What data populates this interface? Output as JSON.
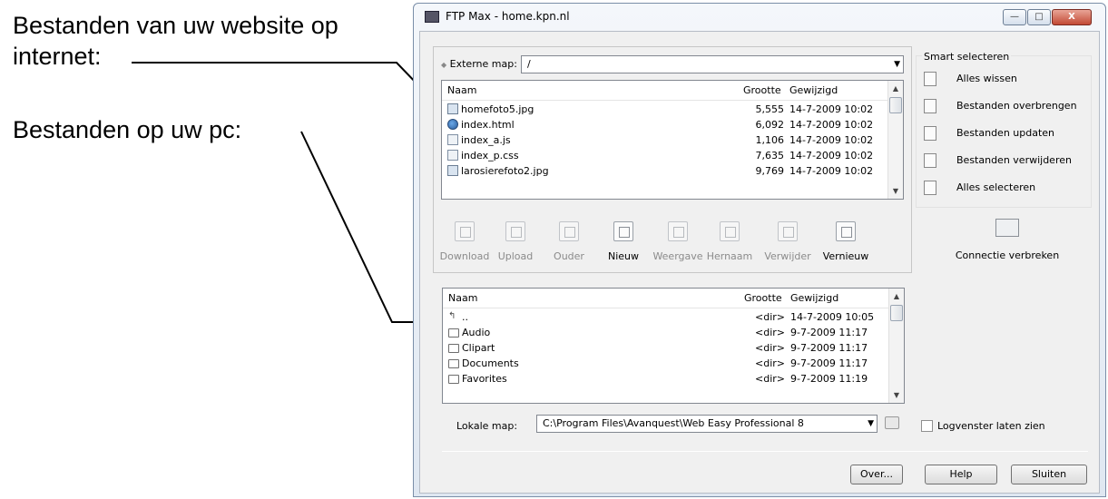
{
  "annotations": {
    "website_files": "Bestanden van uw website op internet:",
    "pc_files": "Bestanden op uw pc:"
  },
  "window": {
    "title": "FTP Max - home.kpn.nl",
    "controls": {
      "minimize": "—",
      "maximize": "□",
      "close": "X"
    }
  },
  "remote": {
    "map_label": "Externe map:",
    "map_value": "/",
    "columns": {
      "name": "Naam",
      "size": "Grootte",
      "modified": "Gewijzigd"
    },
    "files": [
      {
        "name": "homefoto5.jpg",
        "size": "5,555",
        "modified": "14-7-2009 10:02",
        "icon": "image-file-icon"
      },
      {
        "name": "index.html",
        "size": "6,092",
        "modified": "14-7-2009 10:02",
        "icon": "html-file-icon"
      },
      {
        "name": "index_a.js",
        "size": "1,106",
        "modified": "14-7-2009 10:02",
        "icon": "script-file-icon"
      },
      {
        "name": "index_p.css",
        "size": "7,635",
        "modified": "14-7-2009 10:02",
        "icon": "script-file-icon"
      },
      {
        "name": "larosierefoto2.jpg",
        "size": "9,769",
        "modified": "14-7-2009 10:02",
        "icon": "image-file-icon"
      }
    ]
  },
  "toolbar": {
    "download": "Download",
    "upload": "Upload",
    "parent": "Ouder",
    "new": "Nieuw",
    "view": "Weergave",
    "rename": "Hernaam",
    "delete": "Verwijder",
    "refresh": "Vernieuw"
  },
  "local": {
    "columns": {
      "name": "Naam",
      "size": "Grootte",
      "modified": "Gewijzigd"
    },
    "files": [
      {
        "name": "..",
        "size": "<dir>",
        "modified": "14-7-2009 10:05",
        "icon": "parent-folder-icon"
      },
      {
        "name": "Audio",
        "size": "<dir>",
        "modified": "9-7-2009 11:17",
        "icon": "folder-icon"
      },
      {
        "name": "Clipart",
        "size": "<dir>",
        "modified": "9-7-2009 11:17",
        "icon": "folder-icon"
      },
      {
        "name": "Documents",
        "size": "<dir>",
        "modified": "9-7-2009 11:17",
        "icon": "folder-icon"
      },
      {
        "name": "Favorites",
        "size": "<dir>",
        "modified": "9-7-2009 11:19",
        "icon": "folder-icon"
      }
    ],
    "map_label": "Lokale map:",
    "map_value": "C:\\Program Files\\Avanquest\\Web Easy Professional 8"
  },
  "smart": {
    "title": "Smart selecteren",
    "items": [
      "Alles wissen",
      "Bestanden overbrengen",
      "Bestanden updaten",
      "Bestanden verwijderen",
      "Alles selecteren"
    ],
    "disconnect": "Connectie verbreken",
    "log_label": "Logvenster laten zien"
  },
  "footer": {
    "about": "Over...",
    "help": "Help",
    "close": "Sluiten"
  }
}
